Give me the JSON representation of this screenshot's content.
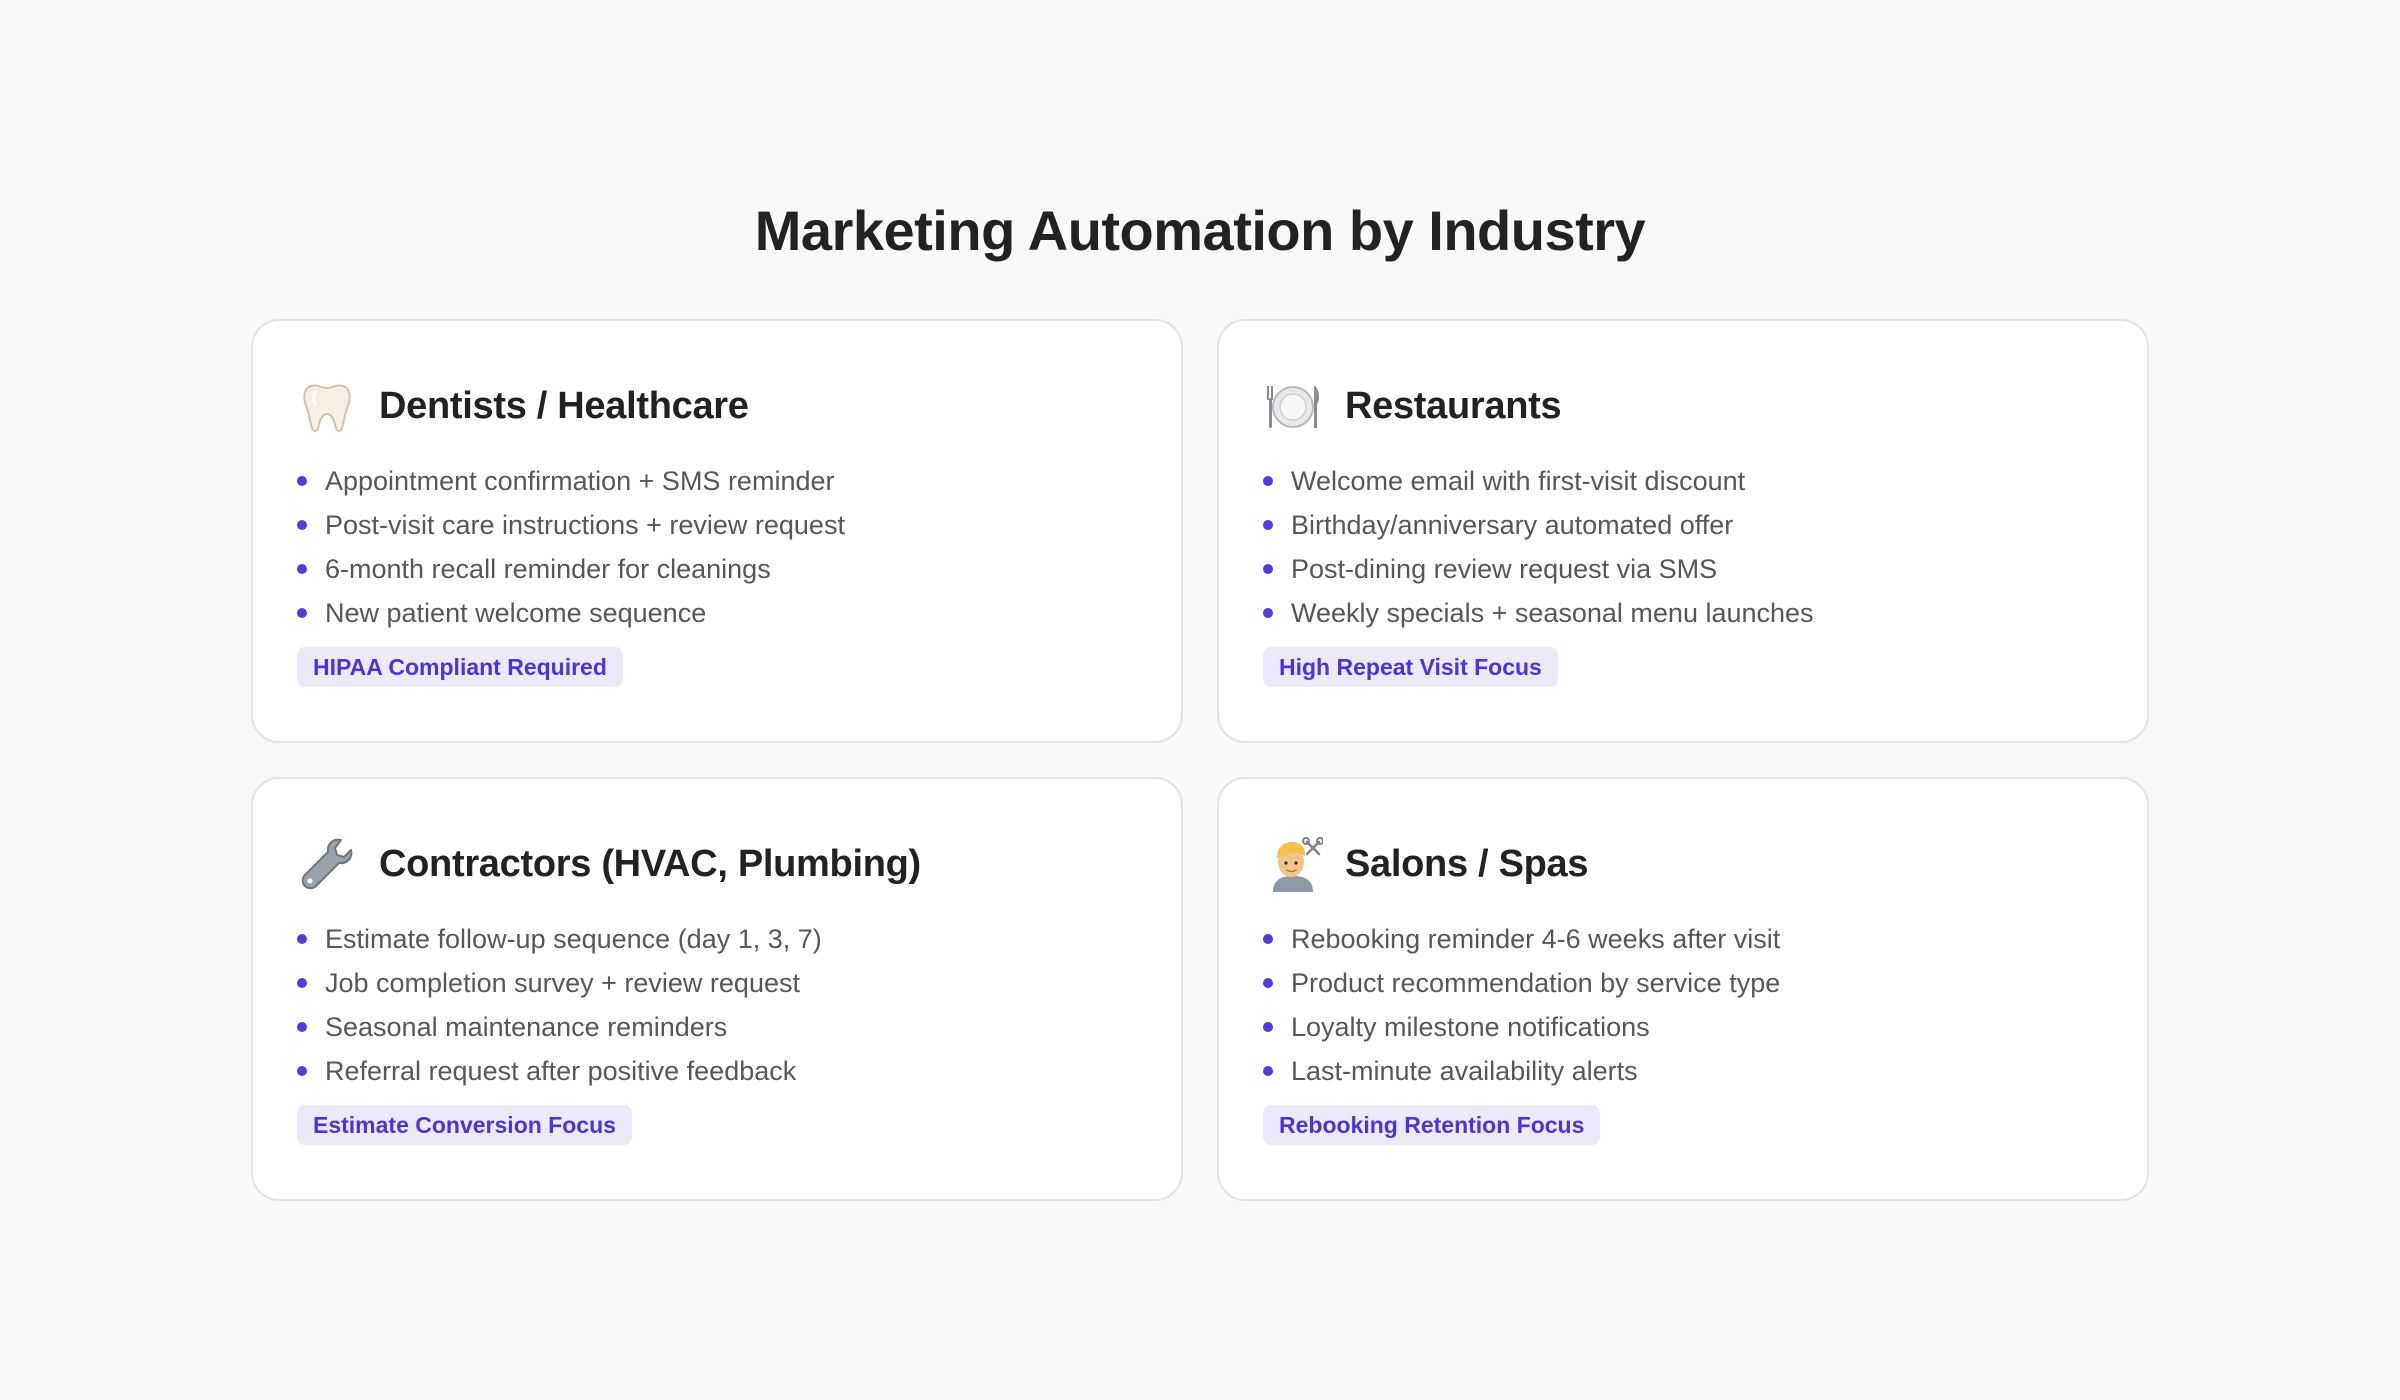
{
  "page": {
    "title": "Marketing Automation by Industry"
  },
  "colors": {
    "accent": "#4f3de0",
    "tag_background": "#ece9fb",
    "background": "#faf9f7"
  },
  "cards": [
    {
      "icon": "tooth-icon",
      "title": "Dentists / Healthcare",
      "items": [
        "Appointment confirmation + SMS reminder",
        "Post-visit care instructions + review request",
        "6-month recall reminder for cleanings",
        "New patient welcome sequence"
      ],
      "tag": "HIPAA Compliant Required"
    },
    {
      "icon": "plate-cutlery-icon",
      "title": "Restaurants",
      "items": [
        "Welcome email with first-visit discount",
        "Birthday/anniversary automated offer",
        "Post-dining review request via SMS",
        "Weekly specials + seasonal menu launches"
      ],
      "tag": "High Repeat Visit Focus"
    },
    {
      "icon": "wrench-icon",
      "title": "Contractors (HVAC, Plumbing)",
      "items": [
        "Estimate follow-up sequence (day 1, 3, 7)",
        "Job completion survey + review request",
        "Seasonal maintenance reminders",
        "Referral request after positive feedback"
      ],
      "tag": "Estimate Conversion Focus"
    },
    {
      "icon": "haircut-icon",
      "title": "Salons / Spas",
      "items": [
        "Rebooking reminder 4-6 weeks after visit",
        "Product recommendation by service type",
        "Loyalty milestone notifications",
        "Last-minute availability alerts"
      ],
      "tag": "Rebooking Retention Focus"
    }
  ]
}
